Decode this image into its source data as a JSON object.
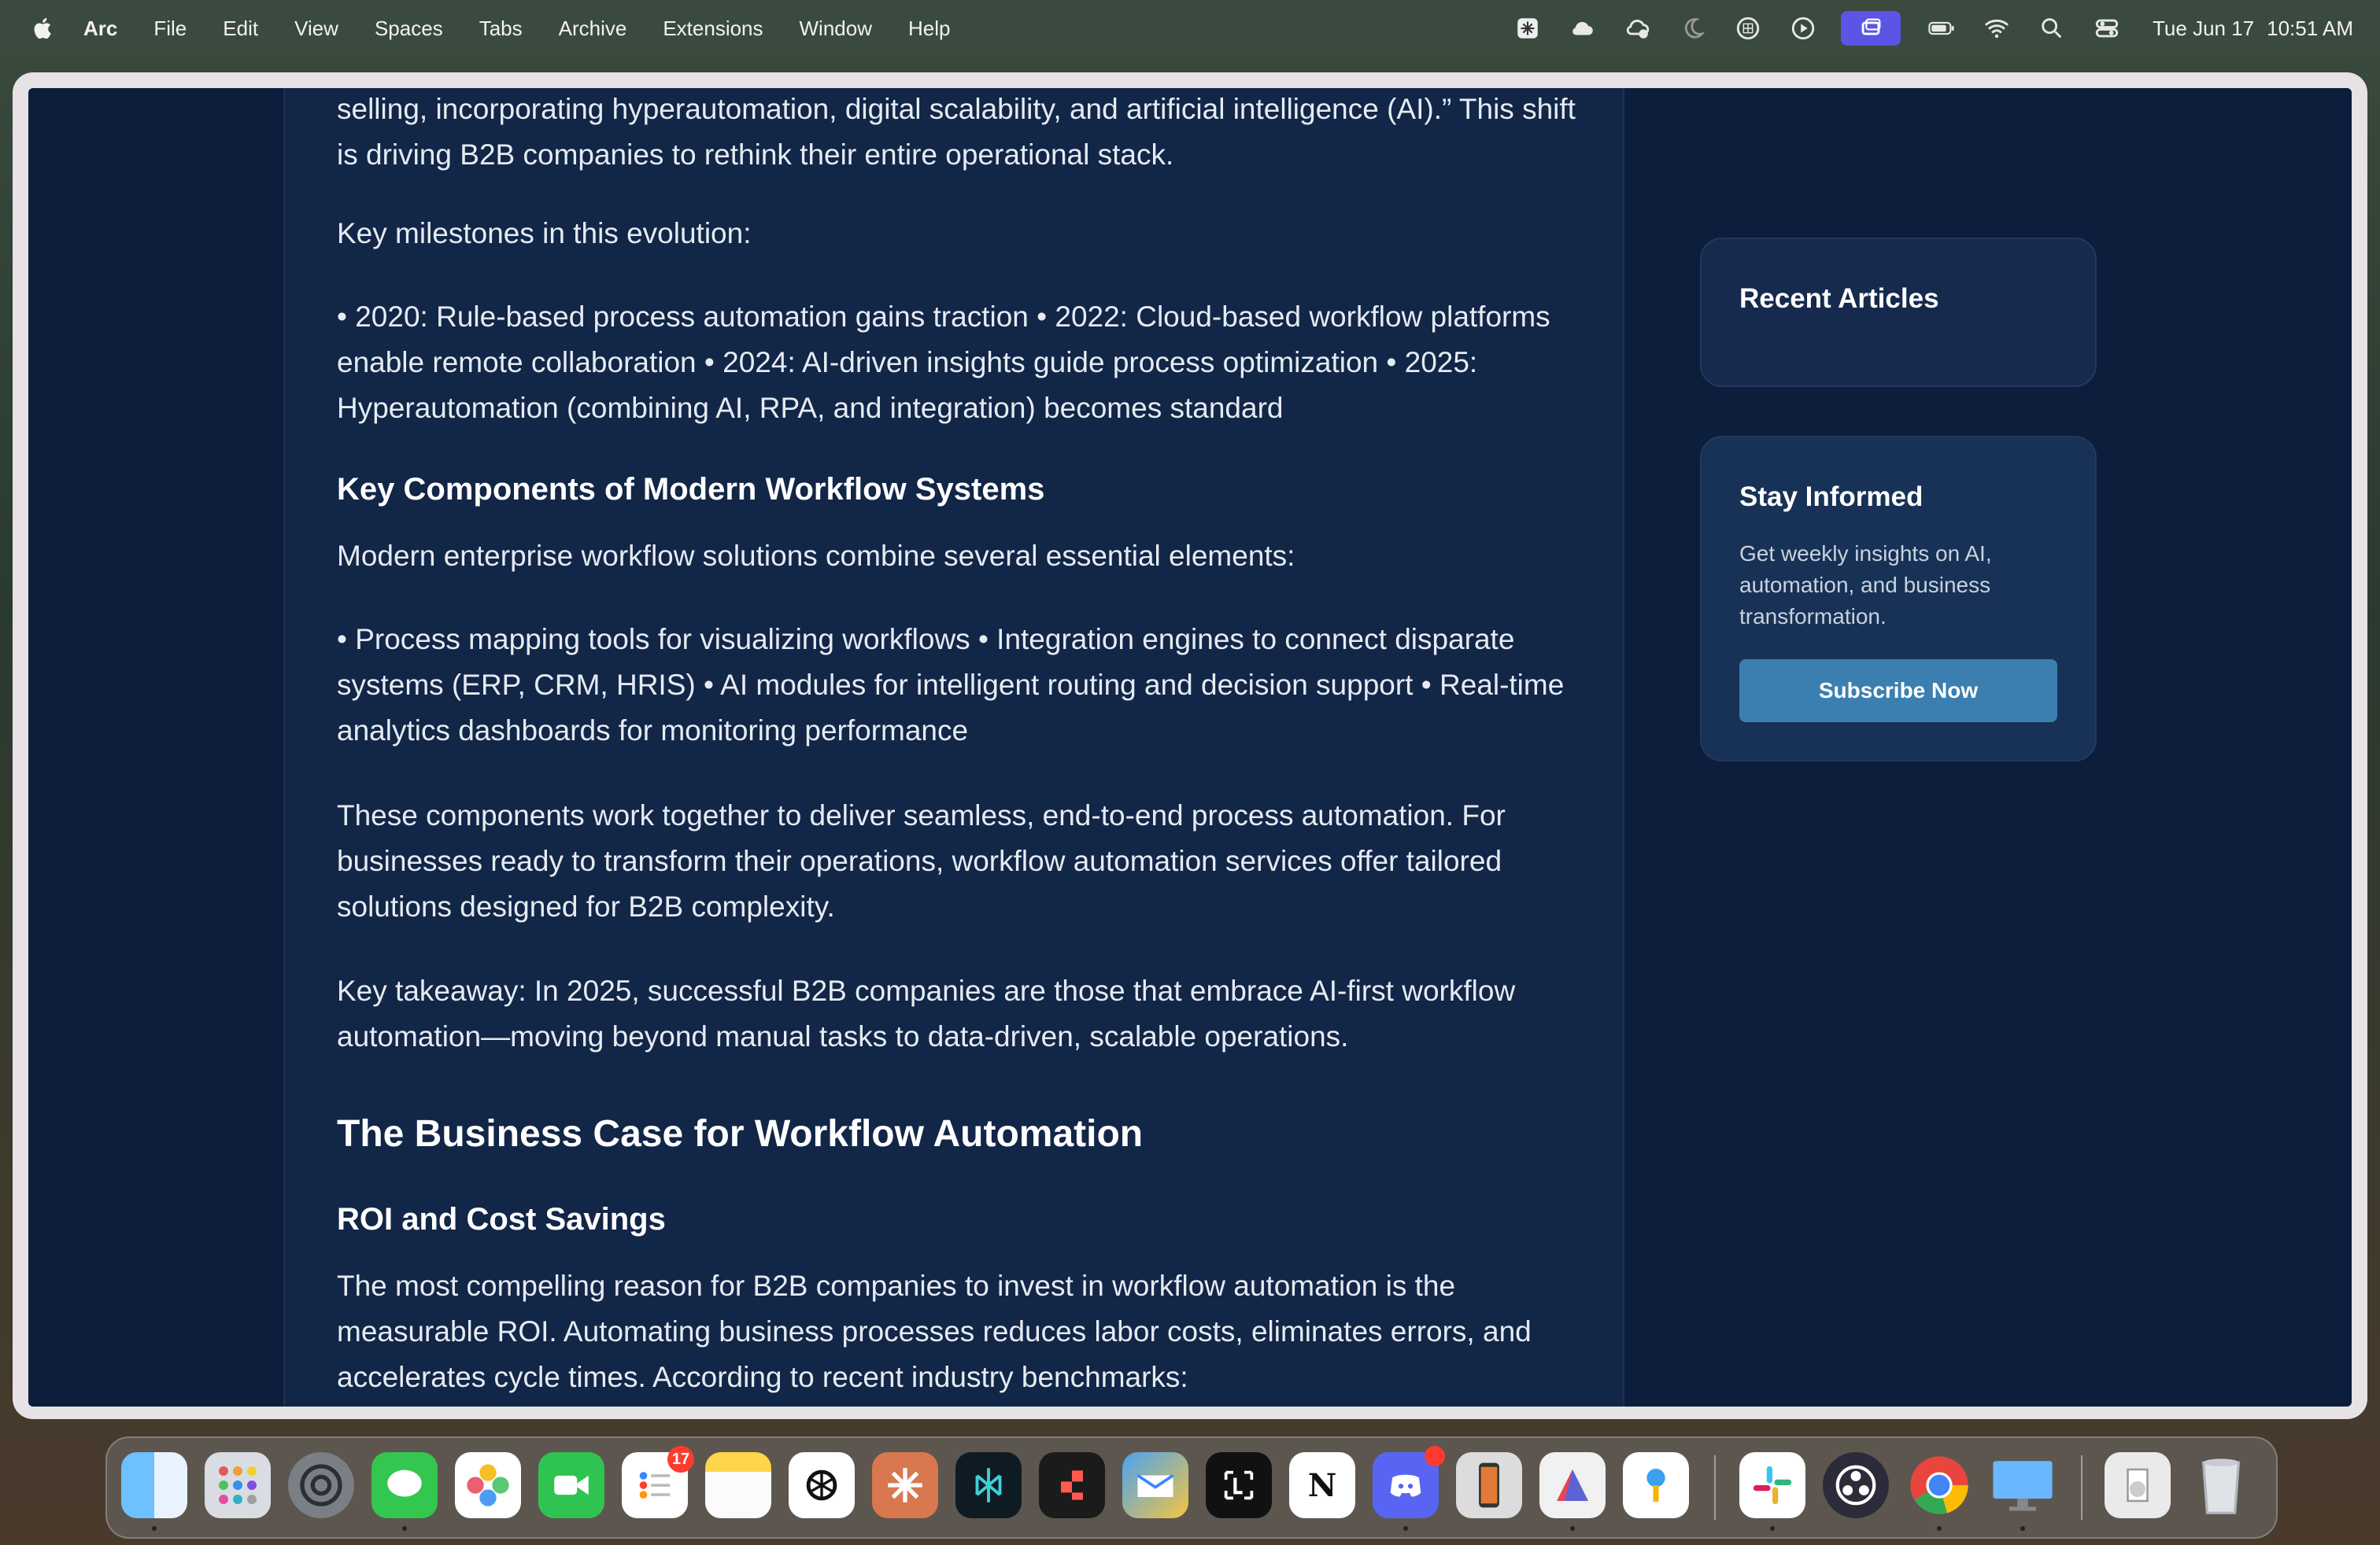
{
  "menubar": {
    "app_name": "Arc",
    "items": [
      "File",
      "Edit",
      "View",
      "Spaces",
      "Tabs",
      "Archive",
      "Extensions",
      "Window",
      "Help"
    ],
    "clock_date": "Tue Jun 17",
    "clock_time": "10:51 AM",
    "tray_icons": [
      "perplexity-icon",
      "cloud-icon",
      "cloud-sync-icon",
      "moon-icon",
      "grid-icon",
      "play-icon",
      "screen-mirroring-icon",
      "battery-icon",
      "wifi-icon",
      "search-icon",
      "control-center-icon"
    ]
  },
  "article": {
    "intro_paragraph": "selling, incorporating hyperautomation, digital scalability, and artificial intelligence (AI).” This shift is driving B2B companies to rethink their entire operational stack.",
    "milestones_intro": "Key milestones in this evolution:",
    "milestones_list": "• 2020: Rule-based process automation gains traction • 2022: Cloud-based workflow platforms enable remote collaboration • 2024: AI-driven insights guide process optimization • 2025: Hyperautomation (combining AI, RPA, and integration) becomes standard",
    "components_heading": "Key Components of Modern Workflow Systems",
    "components_intro": "Modern enterprise workflow solutions combine several essential elements:",
    "components_list": "• Process mapping tools for visualizing workflows • Integration engines to connect disparate systems (ERP, CRM, HRIS) • AI modules for intelligent routing and decision support • Real-time analytics dashboards for monitoring performance",
    "components_summary": "These components work together to deliver seamless, end-to-end process automation. For businesses ready to transform their operations, workflow automation services offer tailored solutions designed for B2B complexity.",
    "takeaway": "Key takeaway: In 2025, successful B2B companies are those that embrace AI-first workflow automation—moving beyond manual tasks to data-driven, scalable operations.",
    "business_case_heading": "The Business Case for Workflow Automation",
    "roi_heading": "ROI and Cost Savings",
    "roi_paragraph": "The most compelling reason for B2B companies to invest in workflow automation is the measurable ROI. Automating business processes reduces labor costs, eliminates errors, and accelerates cycle times. According to recent industry benchmarks:"
  },
  "sidebar": {
    "recent_title": "Recent Articles",
    "newsletter_title": "Stay Informed",
    "newsletter_text": "Get weekly insights on AI, automation, and business transformation.",
    "subscribe_label": "Subscribe Now"
  },
  "dock": {
    "apps": [
      "finder-icon",
      "launchpad-icon",
      "system-settings-icon",
      "messages-icon",
      "photos-icon",
      "facetime-icon",
      "reminders-icon",
      "notes-icon",
      "chatgpt-icon",
      "claude-icon",
      "perplexity-icon",
      "raycast-icon",
      "airmail-icon",
      "linear-icon",
      "notion-icon",
      "discord-icon",
      "iphone-mirroring-icon",
      "affinity-icon",
      "passwords-icon",
      "slack-icon",
      "obs-icon",
      "chrome-icon",
      "screen-sharing-icon",
      "downloads-folder-icon",
      "trash-icon"
    ],
    "reminders_badge": "17"
  }
}
